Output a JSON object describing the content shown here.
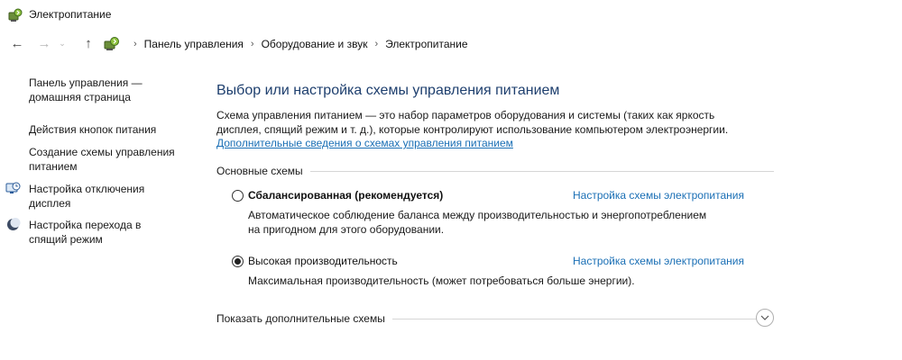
{
  "window": {
    "title": "Электропитание",
    "app_icon": "power-options-icon"
  },
  "nav": {
    "back_icon": "arrow-left-icon",
    "forward_icon": "arrow-right-icon",
    "dropdown_icon": "chevron-down-icon",
    "up_icon": "arrow-up-icon",
    "breadcrumb": [
      "Панель управления",
      "Оборудование и звук",
      "Электропитание"
    ]
  },
  "sidebar": {
    "items": [
      {
        "label_line1": "Панель управления —",
        "label_line2": "домашняя страница",
        "icon": ""
      },
      {
        "label_line1": "Действия кнопок питания",
        "label_line2": "",
        "icon": ""
      },
      {
        "label_line1": "Создание схемы управления",
        "label_line2": "питанием",
        "icon": ""
      },
      {
        "label_line1": "Настройка отключения",
        "label_line2": "дисплея",
        "icon": "display-clock-icon"
      },
      {
        "label_line1": "Настройка перехода в",
        "label_line2": "спящий режим",
        "icon": "moon-icon"
      }
    ]
  },
  "main": {
    "title": "Выбор или настройка схемы управления питанием",
    "description_line1": "Схема управления питанием — это набор параметров оборудования и системы (таких как яркость",
    "description_line2": "дисплея, спящий режим и т. д.), которые контролируют использование компьютером электроэнергии.",
    "more_info_link": "Дополнительные сведения о схемах управления питанием",
    "section_label": "Основные схемы",
    "plans": [
      {
        "name": "Сбалансированная (рекомендуется)",
        "selected": false,
        "settings_link": "Настройка схемы электропитания",
        "description_line1": "Автоматическое соблюдение баланса между производительностью и энергопотреблением",
        "description_line2": "на пригодном для этого оборудовании."
      },
      {
        "name": "Высокая производительность",
        "selected": true,
        "settings_link": "Настройка схемы электропитания",
        "description_line1": "Максимальная производительность (может потребоваться больше энергии).",
        "description_line2": ""
      }
    ],
    "show_more_label": "Показать дополнительные схемы",
    "expand_icon": "chevron-down-circle-icon"
  },
  "colors": {
    "title_blue": "#1e3f6e",
    "link_blue": "#1a6fb5"
  }
}
